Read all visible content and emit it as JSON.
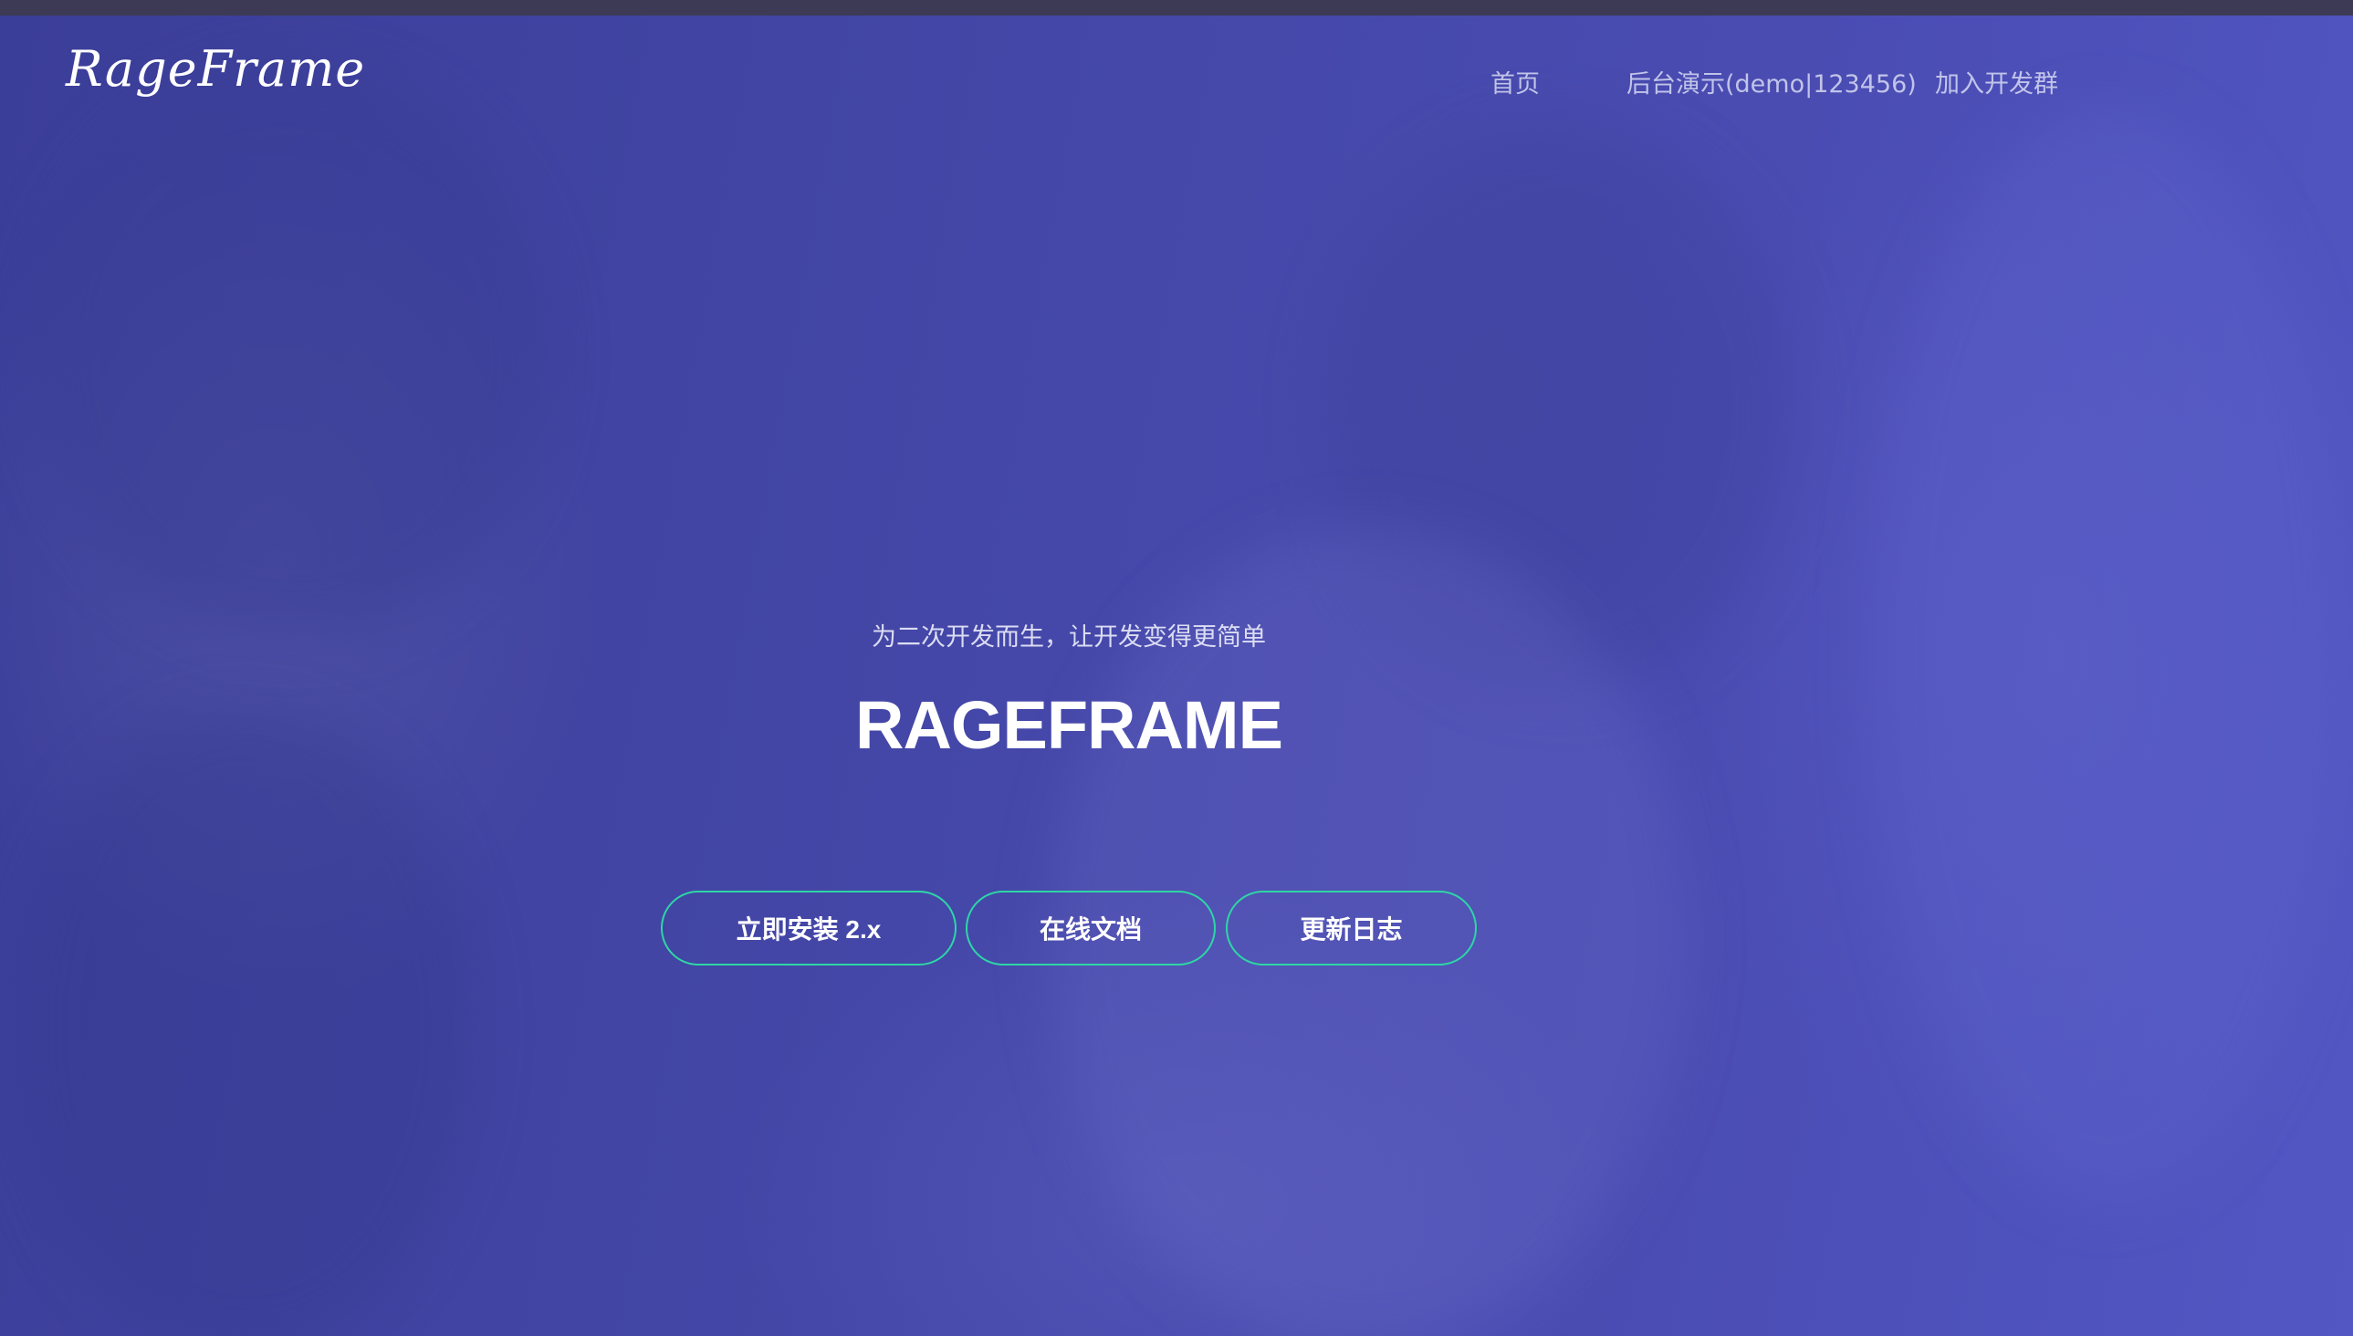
{
  "brand": {
    "logo_text": "RageFrame"
  },
  "nav": {
    "items": [
      {
        "label": "首页"
      },
      {
        "label": "后台演示(demo|123456)"
      },
      {
        "label": "加入开发群"
      }
    ]
  },
  "hero": {
    "tagline": "为二次开发而生，让开发变得更简单",
    "title": "RAGEFRAME",
    "buttons": [
      {
        "label": "立即安装 2.x"
      },
      {
        "label": "在线文档"
      },
      {
        "label": "更新日志"
      }
    ]
  },
  "colors": {
    "background": "#4548a8",
    "topbar": "#3d3a55",
    "button_border": "#2ed6a6",
    "text": "#ffffff"
  }
}
